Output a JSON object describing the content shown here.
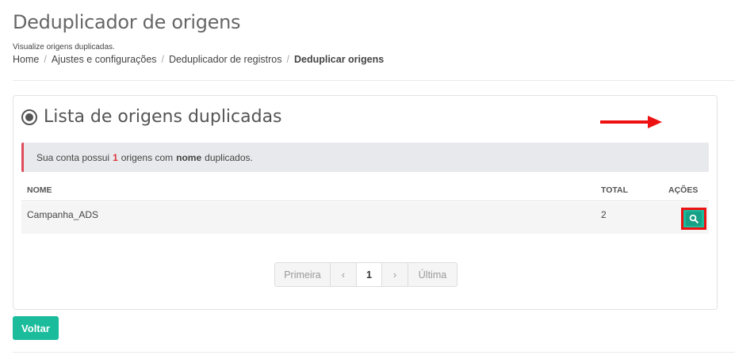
{
  "header": {
    "title": "Deduplicador de origens",
    "subtitle": "Visualize origens duplicadas."
  },
  "breadcrumb": {
    "items": [
      "Home",
      "Ajustes e configurações",
      "Deduplicador de registros"
    ],
    "current": "Deduplicar origens"
  },
  "panel": {
    "title": "Lista de origens duplicadas",
    "icon": "radio-dot-icon",
    "alert": {
      "prefix": "Sua conta possui",
      "count": "1",
      "middle": "origens com",
      "field": "nome",
      "suffix": "duplicados.",
      "accent": "#e04a5a"
    },
    "table": {
      "headers": {
        "nome": "NOME",
        "total": "TOTAL",
        "acoes": "AÇÕES"
      },
      "rows": [
        {
          "nome": "Campanha_ADS",
          "total": "2",
          "action_icon": "search-icon"
        }
      ]
    },
    "pagination": {
      "first": "Primeira",
      "prev": "‹",
      "current": "1",
      "next": "›",
      "last": "Última"
    }
  },
  "footer": {
    "back_label": "Voltar"
  },
  "colors": {
    "primary": "#1abc9c",
    "highlight": "#ee1111"
  }
}
